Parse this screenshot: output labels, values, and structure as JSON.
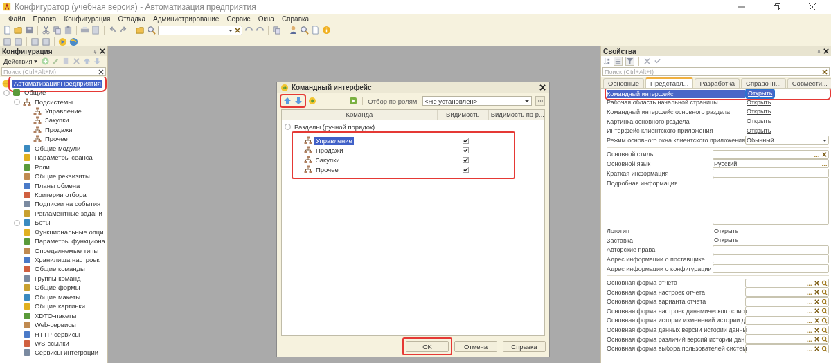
{
  "window": {
    "title": "Конфигуратор (учебная версия) - Автоматизация предприятия"
  },
  "menu": [
    "Файл",
    "Правка",
    "Конфигурация",
    "Отладка",
    "Администрирование",
    "Сервис",
    "Окна",
    "Справка"
  ],
  "config_panel": {
    "title": "Конфигурация",
    "actions_label": "Действия",
    "search": {
      "placeholder": "Поиск (Ctrl+Alt+M)"
    },
    "tree": [
      {
        "label": "АвтоматизацияПредприятия",
        "selected": true,
        "highlighted": true,
        "children": [
          {
            "label": "Общие",
            "selected": false,
            "highlighted": false,
            "expanded": true,
            "children": [
              {
                "label": "Подсистемы",
                "selected": false,
                "highlighted": false,
                "expanded": true,
                "children": [
                  {
                    "label": "Управление",
                    "selected": false,
                    "highlighted": false
                  },
                  {
                    "label": "Закупки",
                    "selected": false,
                    "highlighted": false
                  },
                  {
                    "label": "Продажи",
                    "selected": false,
                    "highlighted": false
                  },
                  {
                    "label": "Прочее",
                    "selected": false,
                    "highlighted": false
                  }
                ]
              },
              {
                "label": "Общие модули",
                "selected": false,
                "highlighted": false
              },
              {
                "label": "Параметры сеанса",
                "selected": false,
                "highlighted": false
              },
              {
                "label": "Роли",
                "selected": false,
                "highlighted": false
              },
              {
                "label": "Общие реквизиты",
                "selected": false,
                "highlighted": false
              },
              {
                "label": "Планы обмена",
                "selected": false,
                "highlighted": false
              },
              {
                "label": "Критерии отбора",
                "selected": false,
                "highlighted": false
              },
              {
                "label": "Подписки на события",
                "selected": false,
                "highlighted": false
              },
              {
                "label": "Регламентные задани",
                "selected": false,
                "highlighted": false
              },
              {
                "label": "Боты",
                "selected": false,
                "highlighted": false,
                "expanded": false
              },
              {
                "label": "Функциональные опци",
                "selected": false,
                "highlighted": false
              },
              {
                "label": "Параметры функциона",
                "selected": false,
                "highlighted": false
              },
              {
                "label": "Определяемые типы",
                "selected": false,
                "highlighted": false
              },
              {
                "label": "Хранилища настроек",
                "selected": false,
                "highlighted": false
              },
              {
                "label": "Общие команды",
                "selected": false,
                "highlighted": false
              },
              {
                "label": "Группы команд",
                "selected": false,
                "highlighted": false
              },
              {
                "label": "Общие формы",
                "selected": false,
                "highlighted": false
              },
              {
                "label": "Общие макеты",
                "selected": false,
                "highlighted": false
              },
              {
                "label": "Общие картинки",
                "selected": false,
                "highlighted": false
              },
              {
                "label": "XDTO-пакеты",
                "selected": false,
                "highlighted": false
              },
              {
                "label": "Web-сервисы",
                "selected": false,
                "highlighted": false
              },
              {
                "label": "HTTP-сервисы",
                "selected": false,
                "highlighted": false
              },
              {
                "label": "WS-ссылки",
                "selected": false,
                "highlighted": false
              },
              {
                "label": "Сервисы интеграции",
                "selected": false,
                "highlighted": false
              }
            ]
          }
        ]
      }
    ]
  },
  "dialog": {
    "title": "Командный интерфейс",
    "toolbar_highlighted": true,
    "filter_label": "Отбор по ролям:",
    "filter_value": "<Не установлен>",
    "columns": [
      "Команда",
      "Видимость",
      "Видимость по р..."
    ],
    "group": {
      "label": "Разделы (ручной порядок)",
      "expanded": true
    },
    "rows_highlighted": true,
    "rows": [
      {
        "name": "Управление",
        "selected": true,
        "checked": true
      },
      {
        "name": "Продажи",
        "selected": false,
        "checked": true
      },
      {
        "name": "Закупки",
        "selected": false,
        "checked": true
      },
      {
        "name": "Прочее",
        "selected": false,
        "checked": true
      }
    ],
    "buttons": [
      {
        "label": "OK",
        "highlighted": true
      },
      {
        "label": "Отмена",
        "highlighted": false
      },
      {
        "label": "Справка",
        "highlighted": false
      }
    ]
  },
  "properties_panel": {
    "title": "Свойства",
    "search": {
      "placeholder": "Поиск (Ctrl+Alt+I)"
    },
    "tabs": [
      {
        "label": "Основные",
        "selected": false
      },
      {
        "label": "Представл...",
        "selected": true
      },
      {
        "label": "Разработка",
        "selected": false
      },
      {
        "label": "Справочн...",
        "selected": false
      },
      {
        "label": "Совмести...",
        "selected": false
      }
    ],
    "sections": [
      [
        {
          "label": "Командный интерфейс",
          "kind": "link",
          "value": "Открыть",
          "selected": true,
          "highlighted": true
        },
        {
          "label": "Рабочая область начальной страницы",
          "kind": "link",
          "value": "Открыть",
          "selected": false,
          "highlighted": false
        },
        {
          "label": "Командный интерфейс основного раздела",
          "kind": "link",
          "value": "Открыть",
          "selected": false,
          "highlighted": false
        },
        {
          "label": "Картинка основного раздела",
          "kind": "link",
          "value": "Открыть",
          "selected": false,
          "highlighted": false
        },
        {
          "label": "Интерфейс клиентского приложения",
          "kind": "link",
          "value": "Открыть",
          "selected": false,
          "highlighted": false
        },
        {
          "label": "Режим основного окна клиентского приложения",
          "kind": "select",
          "value": "Обычный",
          "selected": false,
          "highlighted": false
        }
      ],
      [
        {
          "label": "Основной стиль",
          "kind": "input",
          "choice": true,
          "clear": true,
          "selected": false
        },
        {
          "label": "Основной язык",
          "kind": "input",
          "value": "Русский",
          "choice": true,
          "selected": false
        },
        {
          "label": "Краткая информация",
          "kind": "input",
          "selected": false
        },
        {
          "label": "Подробная информация",
          "kind": "textarea",
          "selected": false
        },
        {
          "label": "Логотип",
          "kind": "link",
          "value": "Открыть",
          "selected": false
        },
        {
          "label": "Заставка",
          "kind": "link",
          "value": "Открыть",
          "selected": false
        },
        {
          "label": "Авторские права",
          "kind": "input",
          "selected": false
        },
        {
          "label": "Адрес информации о поставщике",
          "kind": "input",
          "selected": false
        },
        {
          "label": "Адрес информации о конфигурации",
          "kind": "input",
          "selected": false
        }
      ],
      [
        {
          "label": "Основная форма отчета",
          "kind": "input",
          "choice": true,
          "clear": true,
          "search": true,
          "selected": false
        },
        {
          "label": "Основная форма настроек отчета",
          "kind": "input",
          "choice": true,
          "clear": true,
          "search": true,
          "selected": false
        },
        {
          "label": "Основная форма варианта отчета",
          "kind": "input",
          "choice": true,
          "clear": true,
          "search": true,
          "selected": false
        },
        {
          "label": "Основная форма настроек динамического списк",
          "kind": "input",
          "choice": true,
          "clear": true,
          "search": true,
          "selected": false
        },
        {
          "label": "Основная форма истории изменений истории д",
          "kind": "input",
          "choice": true,
          "clear": true,
          "search": true,
          "selected": false
        },
        {
          "label": "Основная форма данных версии истории данны",
          "kind": "input",
          "choice": true,
          "clear": true,
          "search": true,
          "selected": false
        },
        {
          "label": "Основная форма различий версий истории дан",
          "kind": "input",
          "choice": true,
          "clear": true,
          "search": true,
          "selected": false
        },
        {
          "label": "Основная форма выбора пользователей систем",
          "kind": "input",
          "choice": true,
          "clear": true,
          "search": true,
          "selected": false
        }
      ]
    ]
  }
}
